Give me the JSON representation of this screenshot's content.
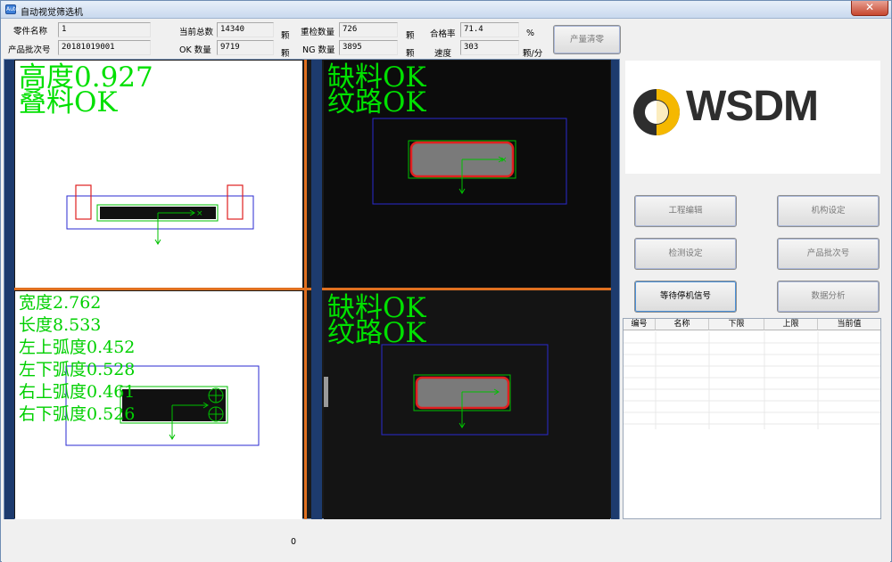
{
  "window": {
    "title": "自动视觉筛选机",
    "app_icon": "Auto"
  },
  "info": {
    "part_name_label": "零件名称",
    "part_name_value": "1",
    "batch_label": "产品批次号",
    "batch_value": "20181019001",
    "current_total_label": "当前总数",
    "current_total_value": "14340",
    "ok_count_label": "OK 数量",
    "ok_count_value": "9719",
    "recheck_label": "重检数量",
    "recheck_value": "726",
    "ng_count_label": "NG 数量",
    "ng_count_value": "3895",
    "pass_rate_label": "合格率",
    "pass_rate_value": "71.4",
    "speed_label": "速度",
    "speed_value": "303",
    "unit_pcs": "颗",
    "unit_percent": "%",
    "unit_speed": "颗/分"
  },
  "buttons": {
    "clear_output": "产量清零",
    "project_edit": "工程编辑",
    "mechanism_settings": "机构设定",
    "detection_settings": "检测设定",
    "product_batch": "产品批次号",
    "waiting_signal": "等待停机信号",
    "data_analysis": "数据分析"
  },
  "views": {
    "top_left": {
      "line1": "高度0.927",
      "line2": "叠料OK"
    },
    "top_right": {
      "line1": "缺料OK",
      "line2": "纹路OK"
    },
    "bottom_left": {
      "lines": [
        "宽度2.762",
        "长度8.533",
        "左上弧度0.452",
        "左下弧度0.528",
        "右上弧度0.461",
        "右下弧度0.526"
      ]
    },
    "bottom_right": {
      "line1": "缺料OK",
      "line2": "纹路OK"
    }
  },
  "logo": {
    "text": "WSDM",
    "colors": {
      "ring": "#2e2e2e",
      "accent": "#f5b800"
    }
  },
  "table": {
    "headers": [
      "编号",
      "名称",
      "下限",
      "上限",
      "当前值"
    ],
    "rows": []
  },
  "status": {
    "value": "0"
  },
  "colors": {
    "overlay_green": "#00e000",
    "roi_blue": "#2a2ad0",
    "defect_red": "#e02020",
    "border_orange": "#e07020"
  }
}
